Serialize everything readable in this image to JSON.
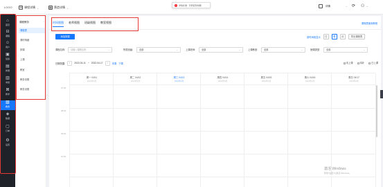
{
  "topbar": {
    "logo": "LOGO",
    "menu1": "课程详情",
    "menu2": "营造详情",
    "notice_text": "详情标准 · 可修复有效期",
    "notice_icon": "exclamation-icon",
    "right_menu": "详情",
    "icons": [
      "help-icon",
      "user-icon"
    ]
  },
  "sidebar": {
    "items": [
      {
        "label": "首页",
        "icon": "home-icon"
      },
      {
        "label": "课程",
        "icon": "book-icon"
      },
      {
        "label": "用户",
        "icon": "users-icon"
      },
      {
        "label": "班级",
        "icon": "class-icon"
      },
      {
        "label": "排课",
        "icon": "schedule-icon"
      },
      {
        "label": "考勤",
        "icon": "attendance-icon"
      },
      {
        "label": "教学",
        "icon": "teach-icon"
      },
      {
        "label": "教务",
        "icon": "admin-icon"
      },
      {
        "label": "数据",
        "icon": "data-icon"
      },
      {
        "label": "订单",
        "icon": "order-icon"
      },
      {
        "label": "设置",
        "icon": "settings-icon"
      }
    ],
    "active_index": 7
  },
  "subnav": {
    "group_label": "课程教务",
    "items": [
      "课程表",
      "课时明细",
      "排课",
      "上课",
      "教室",
      "教务设置",
      "教务设置"
    ],
    "active_index": 0
  },
  "tabs": [
    "时间视图",
    "老师视图",
    "班级视图",
    "教室视图"
  ],
  "active_tab": 0,
  "top_link": "课程表使用教程",
  "add_button": "添加排课",
  "view_controls": {
    "mode_label": "按时间段显示",
    "day": "日",
    "week": "周",
    "month": "月",
    "export": "导出课程表"
  },
  "filters": {
    "course_name_label": "课程名称:",
    "course_name_placeholder": "请输入课程名称",
    "class_label": "所属班级:",
    "class_value": "全部",
    "teacher_label": "上课老师:",
    "teacher_value": "全部",
    "room_label": "上课教室:",
    "room_value": "全部",
    "type_label": "授课类型:",
    "type_value": "全部"
  },
  "date_row": {
    "label": "日期范围:",
    "start": "2022-04-11",
    "end": "2022-04-17",
    "this_week": "本周",
    "next_week": "下周",
    "legend": [
      "未上课",
      "待补",
      "已上课"
    ]
  },
  "calendar": {
    "days": [
      {
        "name": "周一 04/11",
        "sub": "2022年4月"
      },
      {
        "name": "周二 04/12",
        "sub": "2022年4月"
      },
      {
        "name": "周三 04/13",
        "sub": "2022年4月"
      },
      {
        "name": "周四 04/14",
        "sub": "2022年4月"
      },
      {
        "name": "周五 04/15",
        "sub": "2022年4月"
      },
      {
        "name": "周六 04/16",
        "sub": "2022年4月"
      },
      {
        "name": "周日 04/17",
        "sub": "2022年4月"
      }
    ],
    "today_index": 2,
    "times": [
      "07:00",
      "08:00",
      "09:00",
      "10:00"
    ]
  },
  "watermark": {
    "line1": "激活 Windows",
    "line2": "转到\"设置\"以激活 Windows。"
  }
}
